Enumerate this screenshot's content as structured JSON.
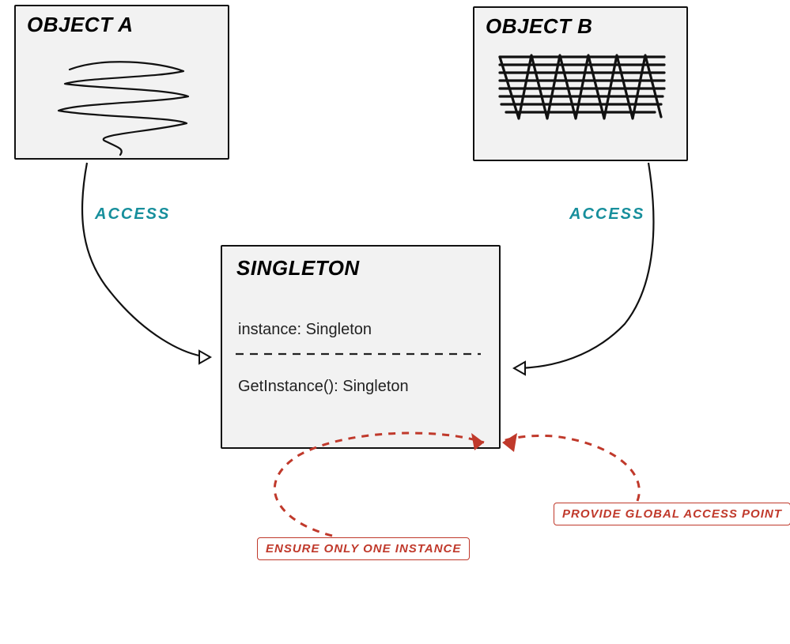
{
  "objectA": {
    "title": "OBJECT A"
  },
  "objectB": {
    "title": "OBJECT B"
  },
  "singleton": {
    "title": "SINGLETON",
    "attribute": "instance: Singleton",
    "method": "GetInstance(): Singleton"
  },
  "labels": {
    "accessLeft": "ACCESS",
    "accessRight": "ACCESS"
  },
  "callouts": {
    "ensure": "ENSURE ONLY ONE INSTANCE",
    "provide": "PROVIDE GLOBAL ACCESS POINT"
  }
}
